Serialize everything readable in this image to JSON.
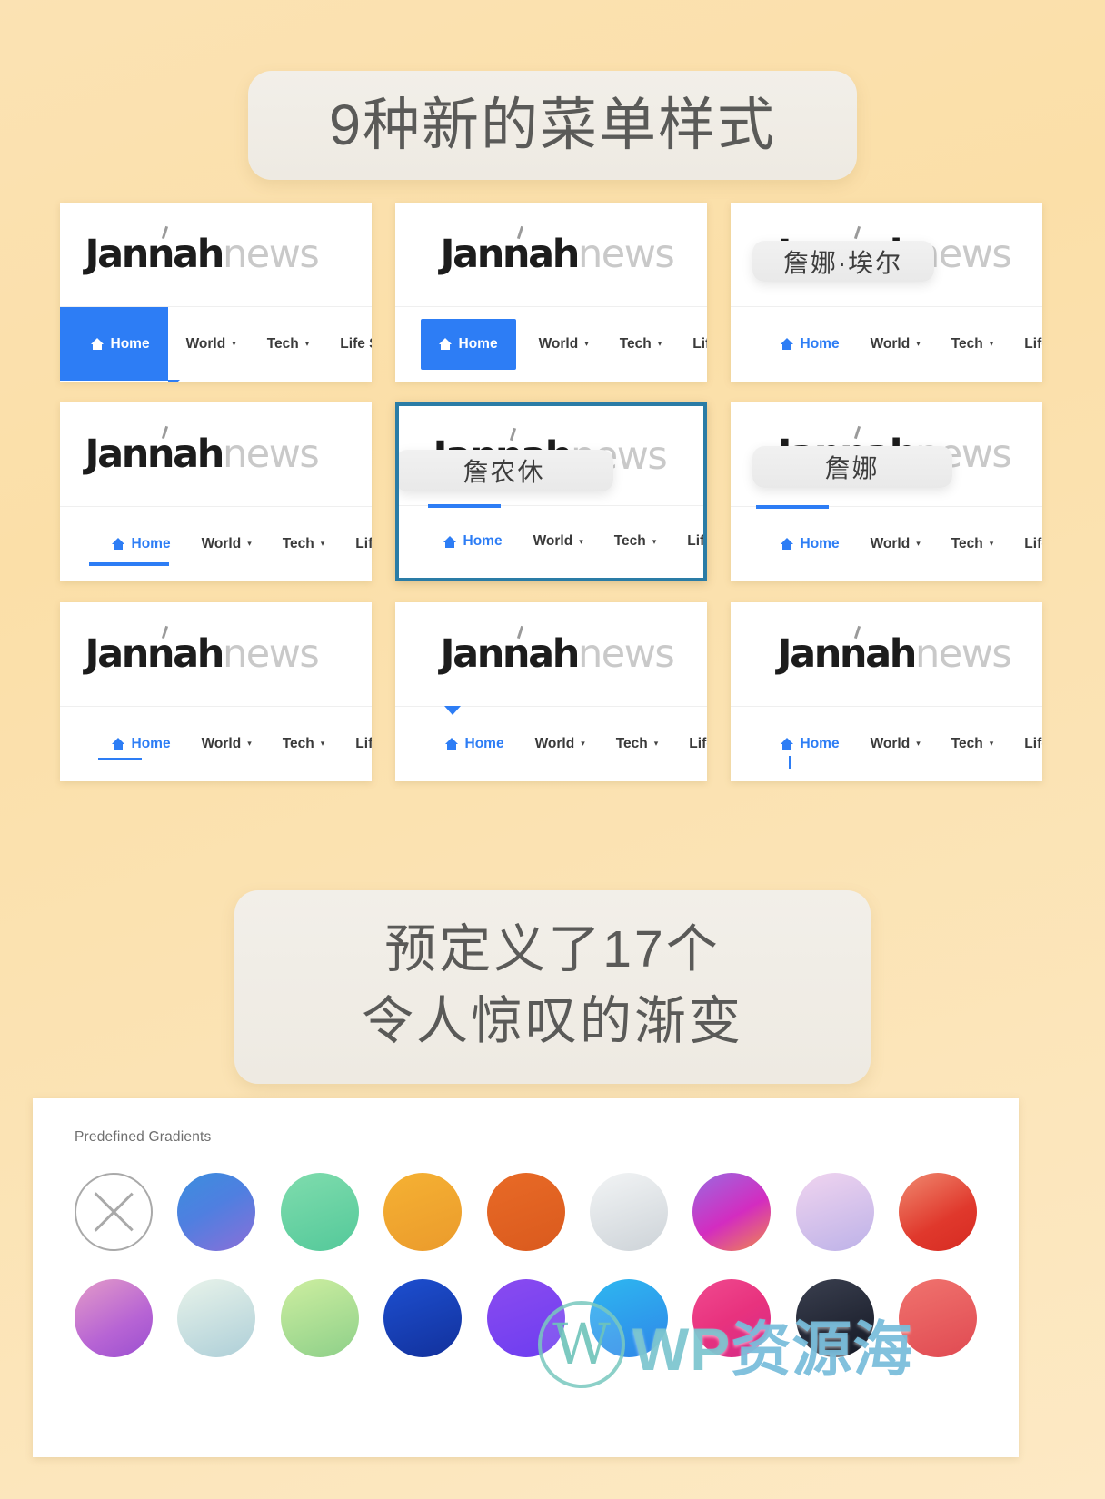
{
  "page": {
    "background_color": "#fbe2b3"
  },
  "headings": {
    "menu_styles": "9种新的菜单样式",
    "gradients_line1": "预定义了17个",
    "gradients_line2": "令人惊叹的渐变"
  },
  "menu_cards": [
    {
      "id": "card-1",
      "style": "blue-pill-tail",
      "logo": {
        "bold": "Jannah",
        "light": "news"
      },
      "items": [
        {
          "label": "Home",
          "icon": "home-icon",
          "active": true,
          "has_caret": false
        },
        {
          "label": "World",
          "has_caret": true
        },
        {
          "label": "Tech",
          "has_caret": true
        },
        {
          "label": "Life Style",
          "has_caret": true
        }
      ],
      "overlay": null,
      "selected": false
    },
    {
      "id": "card-2",
      "style": "blue-box",
      "logo": {
        "bold": "Jannah",
        "light": "news"
      },
      "items": [
        {
          "label": "Home",
          "icon": "home-icon",
          "active": true,
          "has_caret": false
        },
        {
          "label": "World",
          "has_caret": true
        },
        {
          "label": "Tech",
          "has_caret": true
        },
        {
          "label": "Life Style",
          "has_caret": true
        }
      ],
      "overlay": null,
      "selected": false
    },
    {
      "id": "card-3",
      "style": "plain",
      "logo": {
        "bold": "Jannah",
        "light": "news"
      },
      "items": [
        {
          "label": "Home",
          "icon": "home-icon",
          "active": true,
          "has_caret": false
        },
        {
          "label": "World",
          "has_caret": true
        },
        {
          "label": "Tech",
          "has_caret": true
        },
        {
          "label": "Life Style",
          "has_caret": true
        }
      ],
      "overlay": "詹娜·埃尔",
      "selected": false
    },
    {
      "id": "card-4",
      "style": "underline-bottom-long",
      "logo": {
        "bold": "Jannah",
        "light": "news"
      },
      "items": [
        {
          "label": "Home",
          "icon": "home-icon",
          "active": true,
          "has_caret": false
        },
        {
          "label": "World",
          "has_caret": true
        },
        {
          "label": "Tech",
          "has_caret": true
        },
        {
          "label": "Life Style",
          "has_caret": true
        }
      ],
      "overlay": null,
      "selected": false
    },
    {
      "id": "card-5",
      "style": "topline",
      "logo": {
        "bold": "Jannah",
        "light": "news"
      },
      "items": [
        {
          "label": "Home",
          "icon": "home-icon",
          "active": true,
          "has_caret": false
        },
        {
          "label": "World",
          "has_caret": true
        },
        {
          "label": "Tech",
          "has_caret": true
        },
        {
          "label": "Life Style",
          "has_caret": true
        }
      ],
      "overlay": "詹农休",
      "selected": true
    },
    {
      "id": "card-6",
      "style": "topline",
      "logo": {
        "bold": "Jannah",
        "light": "news"
      },
      "items": [
        {
          "label": "Home",
          "icon": "home-icon",
          "active": true,
          "has_caret": false
        },
        {
          "label": "World",
          "has_caret": true
        },
        {
          "label": "Tech",
          "has_caret": true
        },
        {
          "label": "Life Style",
          "has_caret": true
        }
      ],
      "overlay": "詹娜",
      "selected": false
    },
    {
      "id": "card-7",
      "style": "underline-short",
      "logo": {
        "bold": "Jannah",
        "light": "news"
      },
      "items": [
        {
          "label": "Home",
          "icon": "home-icon",
          "active": true,
          "has_caret": false
        },
        {
          "label": "World",
          "has_caret": true
        },
        {
          "label": "Tech",
          "has_caret": true
        },
        {
          "label": "Life Style",
          "has_caret": true
        }
      ],
      "overlay": null,
      "selected": false
    },
    {
      "id": "card-8",
      "style": "caret-above",
      "logo": {
        "bold": "Jannah",
        "light": "news"
      },
      "items": [
        {
          "label": "Home",
          "icon": "home-icon",
          "active": true,
          "has_caret": false
        },
        {
          "label": "World",
          "has_caret": true
        },
        {
          "label": "Tech",
          "has_caret": true
        },
        {
          "label": "Life Style",
          "has_caret": true
        }
      ],
      "overlay": null,
      "selected": false
    },
    {
      "id": "card-9",
      "style": "tick-below",
      "logo": {
        "bold": "Jannah",
        "light": "news"
      },
      "items": [
        {
          "label": "Home",
          "icon": "home-icon",
          "active": true,
          "has_caret": false
        },
        {
          "label": "World",
          "has_caret": true
        },
        {
          "label": "Tech",
          "has_caret": true
        },
        {
          "label": "Life Style",
          "has_caret": true
        }
      ],
      "overlay": null,
      "selected": false
    }
  ],
  "gradients_panel": {
    "label": "Predefined Gradients",
    "rows": [
      [
        {
          "name": "none",
          "type": "none",
          "css": ""
        },
        {
          "name": "blue-purple",
          "css": "linear-gradient(150deg,#3b8ede 0%,#4f7fe0 45%,#8b6fd8 100%)"
        },
        {
          "name": "green-mint",
          "css": "linear-gradient(160deg,#7fdcad 0%,#54c99a 100%)"
        },
        {
          "name": "amber",
          "css": "linear-gradient(160deg,#f5b133 0%,#eb9b2c 100%)"
        },
        {
          "name": "orange-red",
          "css": "linear-gradient(160deg,#e86a26 0%,#da5a1e 100%)"
        },
        {
          "name": "silver",
          "css": "linear-gradient(160deg,#f2f4f5 0%,#cdd3d8 100%)"
        },
        {
          "name": "violet-magenta",
          "css": "linear-gradient(150deg,#9a6ae0 0%,#d32cc0 55%,#f08a4b 100%)"
        },
        {
          "name": "lavender",
          "css": "linear-gradient(160deg,#f0d4ef 0%,#bdb2e8 100%)"
        },
        {
          "name": "red-coral",
          "css": "linear-gradient(150deg,#f08a70 0%,#e0382c 60%,#d62b22 100%)"
        }
      ],
      [
        {
          "name": "pink-purple",
          "css": "linear-gradient(150deg,#e39bc8 0%,#b764d4 60%,#9b4fd0 100%)"
        },
        {
          "name": "pale-mint",
          "css": "linear-gradient(160deg,#e8f3ea 0%,#aecfd8 100%)"
        },
        {
          "name": "lime-green",
          "css": "linear-gradient(160deg,#cdeea0 0%,#8ed089 100%)"
        },
        {
          "name": "deep-blue",
          "css": "linear-gradient(160deg,#1d4fd0 0%,#12319c 100%)"
        },
        {
          "name": "indigo-violet",
          "css": "linear-gradient(160deg,#8a4bf0 0%,#6d3df0 100%)"
        },
        {
          "name": "cyan-blue",
          "css": "linear-gradient(160deg,#2eb7f0 0%,#2f86e8 100%)"
        },
        {
          "name": "pink-rose",
          "css": "linear-gradient(150deg,#f04a8f 0%,#e8327e 50%,#d42a88 100%)"
        },
        {
          "name": "charcoal",
          "css": "linear-gradient(160deg,#3a3f4f 0%,#141824 100%)"
        },
        {
          "name": "salmon",
          "css": "linear-gradient(160deg,#f0736e 0%,#e04a52 100%)"
        }
      ]
    ]
  },
  "watermark": {
    "symbol": "W",
    "text_en": "WP",
    "text_cn": "资源海"
  }
}
